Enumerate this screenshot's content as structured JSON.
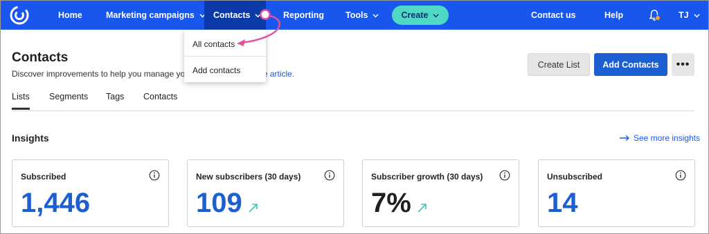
{
  "nav": {
    "home": "Home",
    "marketing": "Marketing campaigns",
    "contacts": "Contacts",
    "reporting": "Reporting",
    "tools": "Tools",
    "create": "Create",
    "contact_us": "Contact us",
    "help": "Help",
    "user_initials": "TJ"
  },
  "dropdown": {
    "items": [
      "All contacts",
      "Add contacts"
    ]
  },
  "header": {
    "title": "Contacts",
    "subtitle_prefix": "Discover improvements to help you manage yo",
    "subtitle_link": "wledge base article.",
    "create_list": "Create List",
    "add_contacts": "Add Contacts",
    "more": "•••"
  },
  "tabs": [
    "Lists",
    "Segments",
    "Tags",
    "Contacts"
  ],
  "insights": {
    "title": "Insights",
    "see_more": "See more insights",
    "cards": [
      {
        "label": "Subscribed",
        "value": "1,446",
        "trend": ""
      },
      {
        "label": "New subscribers (30 days)",
        "value": "109",
        "trend": "up"
      },
      {
        "label": "Subscriber growth (30 days)",
        "value": "7%",
        "trend": "up"
      },
      {
        "label": "Unsubscribed",
        "value": "14",
        "trend": ""
      }
    ]
  },
  "colors": {
    "nav_bg": "#1856ed",
    "nav_active": "#0b3aa8",
    "create_bg": "#4fd9c4",
    "primary": "#1c5fd1",
    "annotation": "#e0529c",
    "trend": "#3cc4b0"
  },
  "icons": {
    "logo": "constant-contact-logo-icon",
    "chevron": "chevron-down-icon",
    "bell": "bell-icon",
    "info": "info-icon",
    "arrow": "arrow-right-icon",
    "trend": "trend-up-icon"
  }
}
